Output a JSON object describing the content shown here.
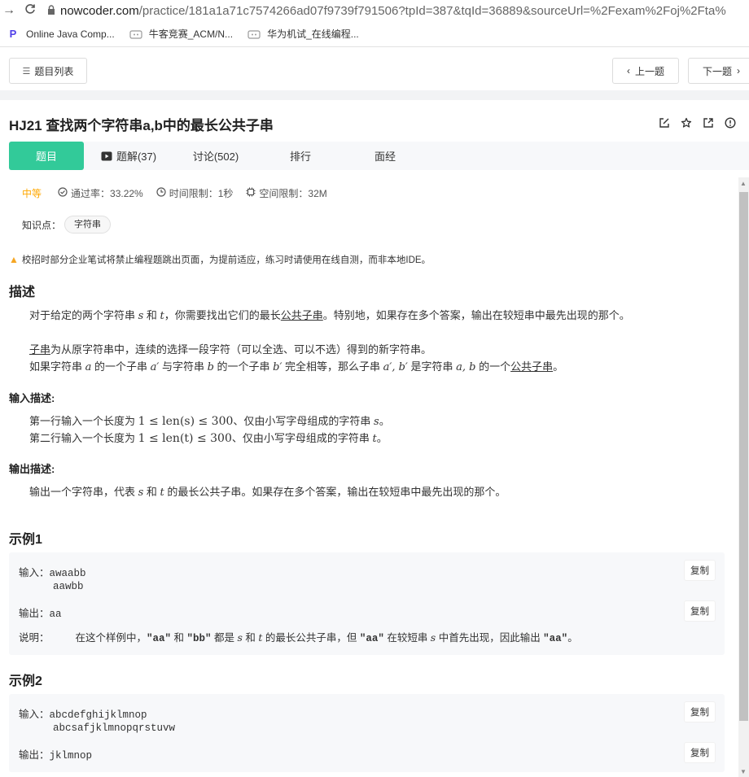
{
  "browser": {
    "url_host": "nowcoder.com",
    "url_path": "/practice/181a1a71c7574266ad07f9739f791506?tpId=387&tqId=36889&sourceUrl=%2Fexam%2Foj%2Fta%",
    "bookmarks": [
      {
        "label": "Online Java Comp...",
        "icon": "p-logo-icon"
      },
      {
        "label": "牛客竞赛_ACM/N...",
        "icon": "nowcoder-icon"
      },
      {
        "label": "华为机试_在线编程...",
        "icon": "nowcoder-icon"
      }
    ]
  },
  "topnav": {
    "list_label": "题目列表",
    "prev_label": "上一题",
    "next_label": "下一题"
  },
  "problem": {
    "title": "HJ21  查找两个字符串a,b中的最长公共子串",
    "tabs": [
      "题目",
      "题解(37)",
      "讨论(502)",
      "排行",
      "面经"
    ],
    "active_tab": 0,
    "difficulty": "中等",
    "pass_rate": "通过率：33.22%",
    "time_limit": "时间限制：1秒",
    "space_limit": "空间限制：32M",
    "knowledge_label": "知识点：",
    "knowledge_tag": "字符串",
    "notice": "校招时部分企业笔试将禁止编程题跳出页面，为提前适应，练习时请使用在线自测，而非本地IDE。"
  },
  "description": {
    "heading": "描述",
    "p1_a": "对于给定的两个字符串 ",
    "p1_b": " 和 ",
    "p1_c": "，你需要找出它们的最长",
    "p1_link": "公共子串",
    "p1_d": "。特别地，如果存在多个答案，输出在较短串中最先出现的那个。",
    "p2_link": "子串",
    "p2_rest": "为从原字符串中，连续的选择一段字符（可以全选、可以不选）得到的新字符串。",
    "p3_a": "如果字符串 ",
    "p3_b": " 的一个子串 ",
    "p3_c": " 与字符串 ",
    "p3_d": " 的一个子串 ",
    "p3_e": " 完全相等，那么子串 ",
    "p3_f": " 是字符串 ",
    "p3_g": " 的一个",
    "p3_link": "公共子串",
    "p3_h": "。",
    "var_s": "s",
    "var_t": "t",
    "var_a": "a",
    "var_b": "b",
    "var_ap": "a′",
    "var_bp": "b′",
    "var_apbp": "a′, b′",
    "var_ab": "a, b"
  },
  "input_desc": {
    "heading": "输入描述:",
    "l1_a": "第一行输入一个长度为 ",
    "l1_math": "1 ≤ len(s) ≤ 300",
    "l1_b": "、仅由小写字母组成的字符串 ",
    "l1_var": "s",
    "l1_c": "。",
    "l2_a": "第二行输入一个长度为 ",
    "l2_math": "1 ≤ len(t) ≤ 300",
    "l2_b": "、仅由小写字母组成的字符串 ",
    "l2_var": "t",
    "l2_c": "。"
  },
  "output_desc": {
    "heading": "输出描述:",
    "l1_a": "输出一个字符串，代表 ",
    "l1_s": "s",
    "l1_b": " 和 ",
    "l1_t": "t",
    "l1_c": " 的最长公共子串。如果存在多个答案，输出在较短串中最先出现的那个。"
  },
  "example1": {
    "heading": "示例1",
    "input_label": "输入：",
    "input_lines": [
      "awaabb",
      "aawbb"
    ],
    "output_label": "输出：",
    "output": "aa",
    "explain_label": "说明：",
    "explain_a": "在这个样例中，",
    "q1": "\"aa\"",
    "explain_b": " 和 ",
    "q2": "\"bb\"",
    "explain_c": " 都是 ",
    "vs": "s",
    "explain_d": " 和 ",
    "vt": "t",
    "explain_e": " 的最长公共子串，但 ",
    "q3": "\"aa\"",
    "explain_f": " 在较短串 ",
    "vs2": "s",
    "explain_g": " 中首先出现，因此输出 ",
    "q4": "\"aa\"",
    "explain_h": "。",
    "copy": "复制"
  },
  "example2": {
    "heading": "示例2",
    "input_label": "输入：",
    "input_lines": [
      "abcdefghijklmnop",
      "abcsafjklmnopqrstuvw"
    ],
    "output_label": "输出：",
    "output": "jklmnop",
    "copy": "复制"
  }
}
